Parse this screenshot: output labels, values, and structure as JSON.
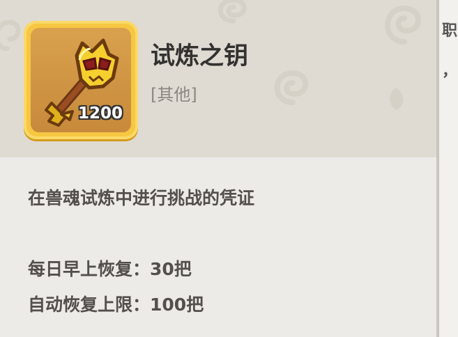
{
  "item": {
    "name": "试炼之钥",
    "category": "[其他]",
    "quantity": "1200",
    "icon": "golden-skull-key-icon"
  },
  "description": "在兽魂试炼中进行挑战的凭证",
  "stats": [
    {
      "label": "每日早上恢复：",
      "value": "30把"
    },
    {
      "label": "自动恢复上限：",
      "value": "100把"
    }
  ],
  "background": {
    "fragment_1": "职",
    "fragment_2": "，"
  },
  "colors": {
    "header_bg": "#dfdbd3",
    "body_bg": "#ecebe7",
    "icon_frame": "#f6c742",
    "text_primary": "#333230",
    "text_secondary": "#8b8781"
  }
}
